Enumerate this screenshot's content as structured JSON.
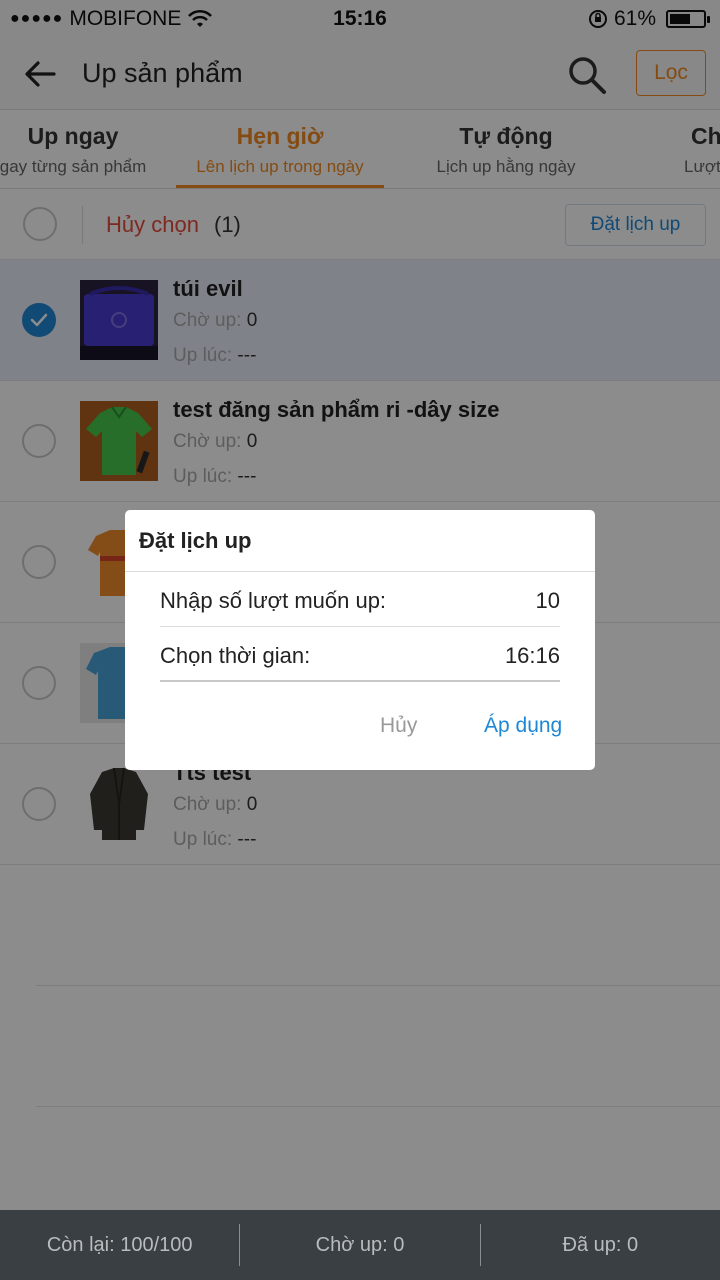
{
  "status_bar": {
    "signal": "●●●●●",
    "carrier": "MOBIFONE",
    "time": "15:16",
    "battery_text": "61%",
    "battery_level": 0.61
  },
  "nav": {
    "title": "Up sản phẩm",
    "filter_label": "Lọc"
  },
  "tabs": [
    {
      "title": "Up ngay",
      "subtitle": "gay từng sản phẩm"
    },
    {
      "title": "Hẹn giờ",
      "subtitle": "Lên lịch up trong ngày"
    },
    {
      "title": "Tự động",
      "subtitle": "Lịch up hằng ngày"
    },
    {
      "title": "Ch",
      "subtitle": "Lượt"
    }
  ],
  "select_bar": {
    "cancel_label": "Hủy chọn",
    "count": "(1)",
    "schedule_button": "Đặt lịch up"
  },
  "products": [
    {
      "name": "túi evil",
      "wait_label": "Chờ up:",
      "wait_value": "0",
      "time_label": "Up lúc:",
      "time_value": "---"
    },
    {
      "name": "test đăng sản phẩm ri -dây size",
      "wait_label": "Chờ up:",
      "wait_value": "0",
      "time_label": "Up lúc:",
      "time_value": "---"
    },
    {
      "name": "",
      "wait_label": "",
      "wait_value": "",
      "time_label": "",
      "time_value": ""
    },
    {
      "name": "",
      "wait_label": "",
      "wait_value": "",
      "time_label": "",
      "time_value": ""
    },
    {
      "name": "Tts test",
      "wait_label": "Chờ up:",
      "wait_value": "0",
      "time_label": "Up lúc:",
      "time_value": "---"
    }
  ],
  "bottom_bar": {
    "remaining": "Còn lại: 100/100",
    "waiting": "Chờ up: 0",
    "done": "Đã up: 0"
  },
  "dialog": {
    "title": "Đặt lịch up",
    "quantity_label": "Nhập số lượt muốn up:",
    "quantity_value": "10",
    "time_label": "Chọn thời gian:",
    "time_value": "16:16",
    "cancel_label": "Hủy",
    "apply_label": "Áp dụng"
  },
  "colors": {
    "accent_orange": "#f08a24",
    "accent_blue": "#1e88d6",
    "danger_red": "#e54b3c"
  }
}
